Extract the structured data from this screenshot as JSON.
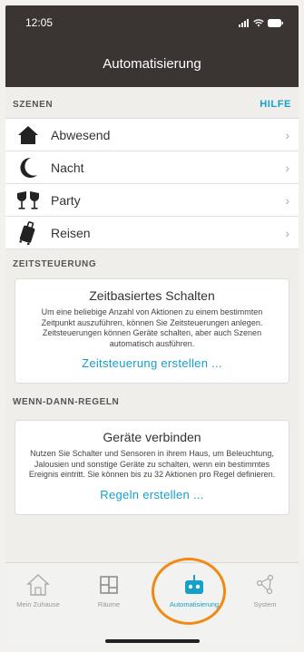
{
  "status": {
    "time": "12:05"
  },
  "header": {
    "title": "Automatisierung"
  },
  "scenes": {
    "heading": "SZENEN",
    "help_label": "HILFE",
    "items": [
      {
        "label": "Abwesend",
        "icon": "house-icon"
      },
      {
        "label": "Nacht",
        "icon": "moon-icon"
      },
      {
        "label": "Party",
        "icon": "glasses-icon"
      },
      {
        "label": "Reisen",
        "icon": "suitcase-icon"
      }
    ]
  },
  "timer": {
    "heading": "ZEITSTEUERUNG",
    "title": "Zeitbasiertes Schalten",
    "text": "Um eine beliebige Anzahl von Aktionen zu einem bestimmten Zeitpunkt auszuführen, können Sie Zeitsteuerungen anlegen. Zeitsteuerungen können Geräte schalten, aber auch Szenen automatisch ausführen.",
    "action": "Zeitsteuerung erstellen ..."
  },
  "rules": {
    "heading": "WENN-DANN-REGELN",
    "title": "Geräte verbinden",
    "text": "Nutzen Sie Schalter und Sensoren in ihrem Haus, um Beleuchtung, Jalousien und sonstige Geräte zu schalten, wenn ein bestimmtes Ereignis eintritt. Sie können bis zu 32 Aktionen pro Regel definieren.",
    "action": "Regeln erstellen ..."
  },
  "tabs": [
    {
      "label": "Mein Zuhause",
      "icon": "home-outline-icon"
    },
    {
      "label": "Räume",
      "icon": "rooms-icon"
    },
    {
      "label": "Automatisierung",
      "icon": "robot-icon",
      "active": true
    },
    {
      "label": "System",
      "icon": "network-icon"
    }
  ],
  "colors": {
    "accent": "#14a0c8",
    "header": "#3a3533",
    "highlight": "#f08a12"
  }
}
